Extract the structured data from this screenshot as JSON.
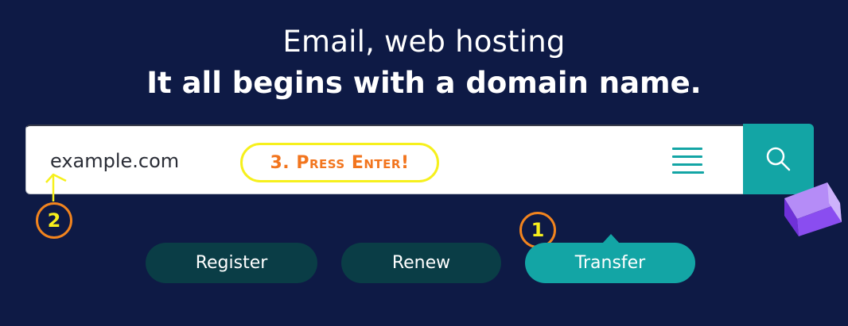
{
  "hero": {
    "line1": "Email, web hosting",
    "line2": "It all begins with a domain name."
  },
  "search": {
    "value": "example.com",
    "placeholder": "example.com",
    "menu_icon": "menu-lines-icon",
    "search_icon": "search-icon"
  },
  "tabs": [
    {
      "label": "Register",
      "active": false
    },
    {
      "label": "Renew",
      "active": false
    },
    {
      "label": "Transfer",
      "active": true
    }
  ],
  "annotations": {
    "step1": "1",
    "step2": "2",
    "step3": "3. Press Enter!"
  },
  "colors": {
    "background": "#0e1a45",
    "accent": "#13a5a5",
    "tab_inactive": "#0a3d46",
    "annotation_orange": "#f2841e",
    "annotation_yellow": "#f6f01c",
    "cube_purple": "#8a4df0"
  }
}
